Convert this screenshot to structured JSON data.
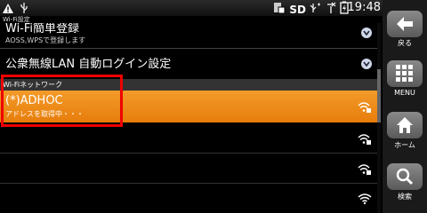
{
  "status_bar": {
    "sd_label": "SD",
    "time": "19:48",
    "icons": [
      "warning-icon",
      "usb-icon",
      "sim-icon",
      "sd-card-icon",
      "usb-debug-icon",
      "no-signal-icon",
      "battery-charging-icon"
    ]
  },
  "window_title": "Wi-Fi設定",
  "settings": {
    "wps_row": {
      "title": "Wi-Fi簡単登録",
      "subtitle": "AOSS,WPSで登録します"
    },
    "public_lan_row": {
      "title": "公衆無線LAN 自動ログイン設定"
    }
  },
  "section_header": "Wi-Fiネットワーク",
  "networks": [
    {
      "ssid": "(*)ADHOC",
      "status": "アドレスを取得中・・・",
      "selected": true,
      "secured": true
    },
    {
      "ssid": "",
      "status": "",
      "selected": false,
      "secured": true
    },
    {
      "ssid": "",
      "status": "",
      "selected": false,
      "secured": true
    },
    {
      "ssid": "",
      "status": "",
      "selected": false,
      "secured": false
    }
  ],
  "sidebar": {
    "back_label": "戻る",
    "menu_label": "MENU",
    "home_label": "ホーム",
    "search_label": "検索"
  },
  "colors": {
    "selected_row": "#f08a1c",
    "highlight_box": "#e00000",
    "chevron_circle": "#cfd8e8"
  }
}
